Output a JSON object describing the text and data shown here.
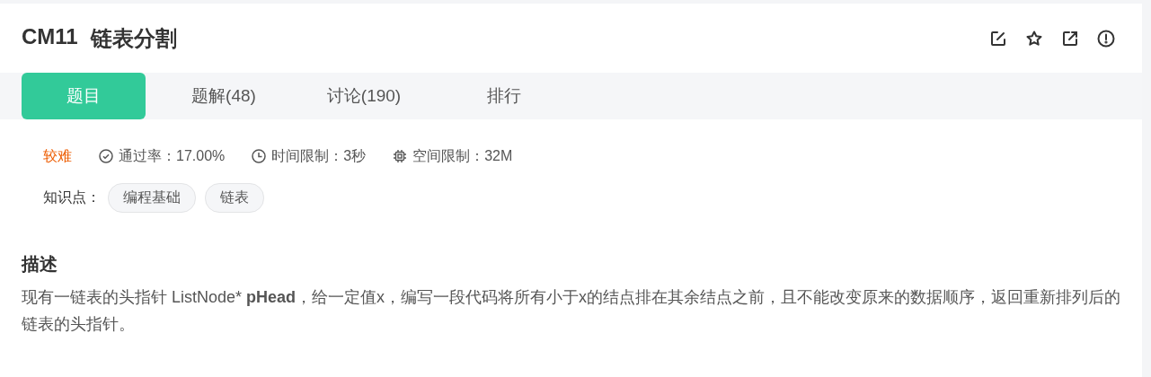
{
  "problem": {
    "code": "CM11",
    "title": "链表分割"
  },
  "tabs": [
    {
      "label": "题目",
      "selected": true
    },
    {
      "label": "题解(48)",
      "selected": false
    },
    {
      "label": "讨论(190)",
      "selected": false
    },
    {
      "label": "排行",
      "selected": false
    }
  ],
  "difficulty": "较难",
  "stats": [
    {
      "kind": "pass",
      "text": "通过率：17.00%"
    },
    {
      "kind": "time",
      "text": "时间限制：3秒"
    },
    {
      "kind": "memory",
      "text": "空间限制：32M"
    }
  ],
  "knowledge": {
    "label": "知识点：",
    "tags": [
      "编程基础",
      "链表"
    ]
  },
  "description": {
    "heading": "描述",
    "text": "现有一链表的头指针 ListNode* **pHead**，给一定值x，编写一段代码将所有小于x的结点排在其余结点之前，且不能改变原来的数据顺序，返回重新排列后的链表的头指针。"
  }
}
